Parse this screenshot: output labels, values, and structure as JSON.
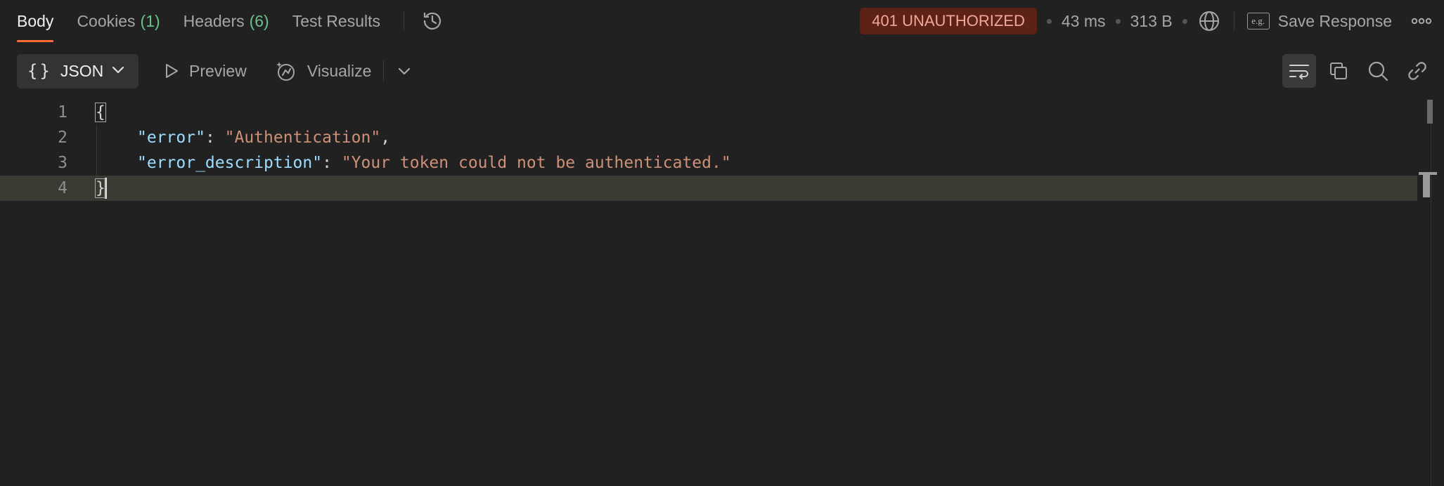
{
  "tabs": [
    {
      "label": "Body",
      "count": ""
    },
    {
      "label": "Cookies",
      "count": "(1)"
    },
    {
      "label": "Headers",
      "count": "(6)"
    },
    {
      "label": "Test Results",
      "count": ""
    }
  ],
  "active_tab": "Body",
  "response_meta": {
    "status": "401 UNAUTHORIZED",
    "time": "43 ms",
    "size": "313 B",
    "save_icon_text": "e.g.",
    "save_label": "Save Response"
  },
  "toolbar": {
    "format_icon": "{}",
    "format_label": "JSON",
    "preview_label": "Preview",
    "visualize_label": "Visualize"
  },
  "editor": {
    "line_numbers": [
      "1",
      "2",
      "3",
      "4"
    ],
    "open_brace": "{",
    "close_brace": "}",
    "lines": [
      {
        "key": "\"error\"",
        "sep": ": ",
        "value": "\"Authentication\"",
        "trail": ","
      },
      {
        "key": "\"error_description\"",
        "sep": ": ",
        "value": "\"Your token could not be authenticated.\"",
        "trail": ""
      }
    ]
  },
  "colors": {
    "accent": "#ff6c37",
    "status_bg": "#5c2216",
    "status_text": "#f0a79a",
    "count_green": "#6cc08a",
    "json_key": "#9cdcfe",
    "json_string": "#ce9178"
  },
  "icons": [
    "history-icon",
    "globe-icon",
    "more-icon",
    "chevron-down-icon",
    "play-icon",
    "visualize-icon",
    "wrap-lines-icon",
    "copy-icon",
    "search-icon",
    "link-icon"
  ]
}
